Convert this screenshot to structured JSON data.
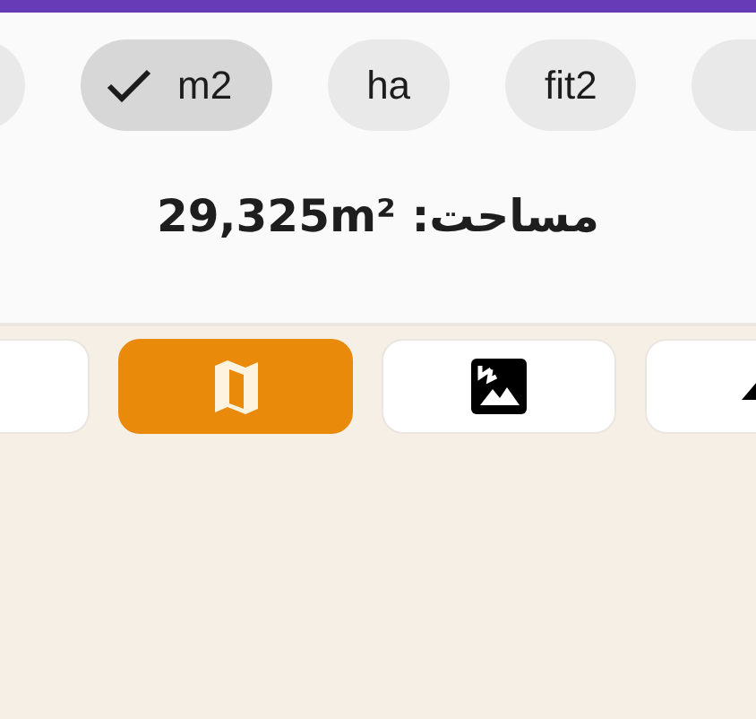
{
  "chips": [
    {
      "label": "fit2",
      "selected": false
    },
    {
      "label": "ha",
      "selected": false
    },
    {
      "label": "m2",
      "selected": true
    }
  ],
  "area_text": "مساحت: 29,325m²",
  "view_tabs": [
    {
      "kind": "clipped",
      "selected": false
    },
    {
      "kind": "map",
      "selected": true
    },
    {
      "kind": "image",
      "selected": false
    },
    {
      "kind": "terrain",
      "selected": false
    }
  ]
}
